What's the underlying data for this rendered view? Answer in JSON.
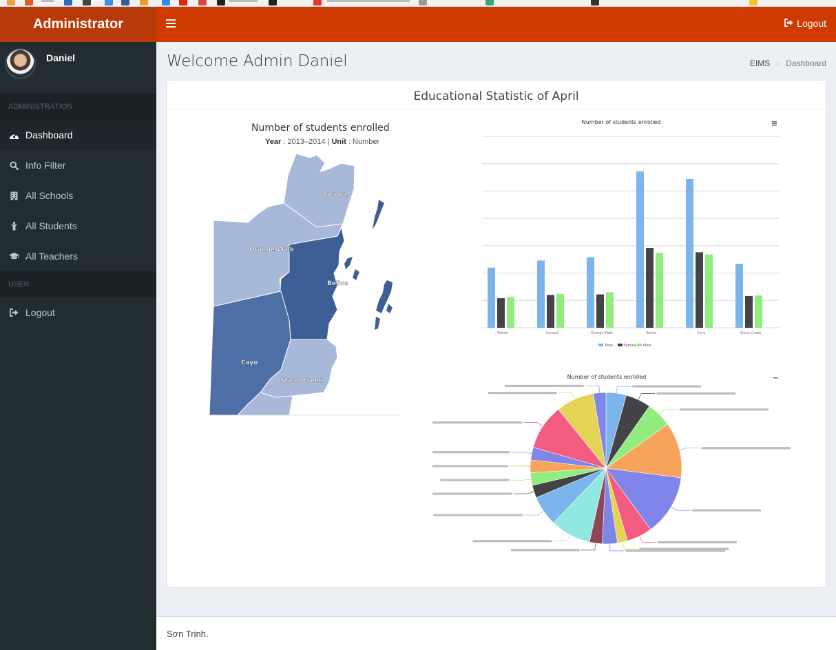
{
  "app": {
    "logo": "Administrator",
    "user_name": "Daniel"
  },
  "sidebar": {
    "header_admin": "ADMINISTRATION",
    "header_user": "USER",
    "items": [
      {
        "label": "Dashboard",
        "icon": "dashboard-icon"
      },
      {
        "label": "Info Filter",
        "icon": "search-icon"
      },
      {
        "label": "All Schools",
        "icon": "building-icon"
      },
      {
        "label": "All Students",
        "icon": "student-icon"
      },
      {
        "label": "All Teachers",
        "icon": "graduation-cap-icon"
      }
    ],
    "logout": "Logout"
  },
  "navbar": {
    "logout": "Logout"
  },
  "content": {
    "title": "Welcome Admin Daniel",
    "breadcrumb": [
      "EIMS",
      "Dashboard"
    ],
    "box_title": "Educational Statistic of April"
  },
  "map": {
    "title": "Number of students enrolled",
    "subtitle_year_label": "Year",
    "subtitle_year": "2013–2014",
    "subtitle_unit_label": "Unit",
    "subtitle_unit": "Number",
    "districts": [
      "Corozal",
      "Orange Walk",
      "Belize",
      "Cayo",
      "Stann Creek"
    ]
  },
  "colors": {
    "brand": "#cf3a00",
    "logo_bg": "#b83a08",
    "sidebar_bg": "#222d32",
    "map_light": "#a8b8d8",
    "map_mid": "#4d6fa6",
    "map_dark": "#3d5f95",
    "total": "#7cb5ec",
    "female": "#434348",
    "male": "#90ed7d"
  },
  "chart_data": [
    {
      "type": "bar",
      "title": "Number of students enrolled",
      "categories": [
        "Toledo",
        "Corozal",
        "Orange Walk",
        "Belize",
        "Cayo",
        "Stann Creek"
      ],
      "series": [
        {
          "name": "Total",
          "values": [
            11,
            12.3,
            12.9,
            28.6,
            27.2,
            11.7
          ]
        },
        {
          "name": "Female",
          "values": [
            5.4,
            6,
            6.1,
            14.6,
            13.8,
            5.8
          ]
        },
        {
          "name": "Male",
          "values": [
            5.6,
            6.2,
            6.5,
            13.7,
            13.4,
            5.9
          ]
        }
      ],
      "ylim": [
        0,
        35
      ],
      "grid": true,
      "legend": "bottom"
    },
    {
      "type": "pie",
      "title": "Number of students enrolled",
      "slices": [
        {
          "color": "#7cb5ec",
          "value": 4
        },
        {
          "color": "#434348",
          "value": 5
        },
        {
          "color": "#90ed7d",
          "value": 5
        },
        {
          "color": "#f7a35c",
          "value": 11
        },
        {
          "color": "#8085e9",
          "value": 12
        },
        {
          "color": "#f15c80",
          "value": 5
        },
        {
          "color": "#e4d354",
          "value": 2
        },
        {
          "color": "#8085e9",
          "value": 3
        },
        {
          "color": "#8d4653",
          "value": 2.5
        },
        {
          "color": "#91e8e1",
          "value": 8
        },
        {
          "color": "#7cb5ec",
          "value": 6
        },
        {
          "color": "#434348",
          "value": 2.5
        },
        {
          "color": "#90ed7d",
          "value": 2.5
        },
        {
          "color": "#f7a35c",
          "value": 2.5
        },
        {
          "color": "#8085e9",
          "value": 2.5
        },
        {
          "color": "#f15c80",
          "value": 9
        },
        {
          "color": "#e4d354",
          "value": 7.5
        },
        {
          "color": "#8085e9",
          "value": 2.5
        }
      ]
    }
  ],
  "footer": {
    "text": "Sơn Trịnh."
  }
}
